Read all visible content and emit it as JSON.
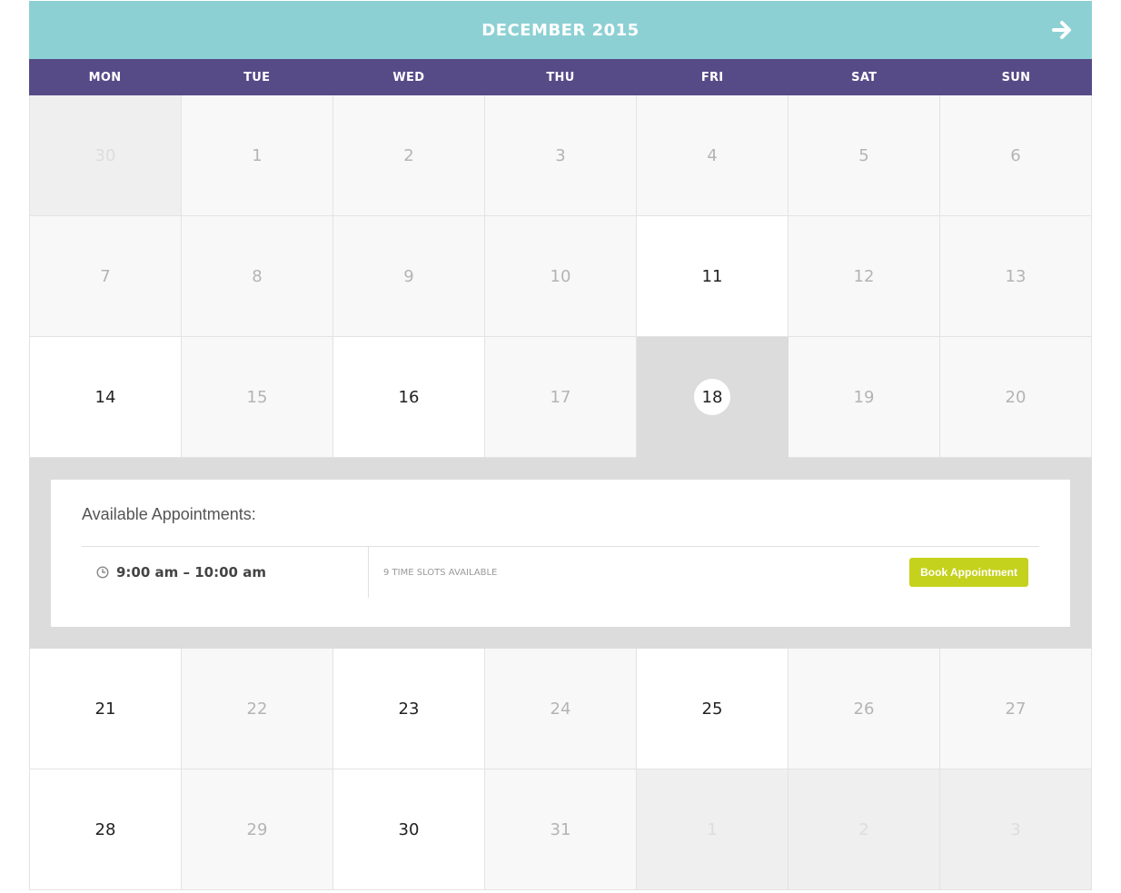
{
  "calendar": {
    "month_title": "DECEMBER 2015",
    "next_icon": "arrow-right-icon",
    "weekdays": [
      "MON",
      "TUE",
      "WED",
      "THU",
      "FRI",
      "SAT",
      "SUN"
    ],
    "weeks": [
      [
        "30",
        "1",
        "2",
        "3",
        "4",
        "5",
        "6"
      ],
      [
        "7",
        "8",
        "9",
        "10",
        "11",
        "12",
        "13"
      ],
      [
        "14",
        "15",
        "16",
        "17",
        "18",
        "19",
        "20"
      ],
      [
        "21",
        "22",
        "23",
        "24",
        "25",
        "26",
        "27"
      ],
      [
        "28",
        "29",
        "30",
        "31",
        "1",
        "2",
        "3"
      ]
    ],
    "selected_day": "18"
  },
  "appointments": {
    "title": "Available Appointments:",
    "slots": [
      {
        "time": "9:00 am – 10:00 am",
        "availability": "9 TIME SLOTS AVAILABLE",
        "button_label": "Book Appointment"
      }
    ]
  },
  "colors": {
    "header_bg": "#8dd0d4",
    "weekday_bg": "#574b87",
    "book_button": "#c5d21d",
    "selected_day_bg": "#dcdcdc"
  }
}
